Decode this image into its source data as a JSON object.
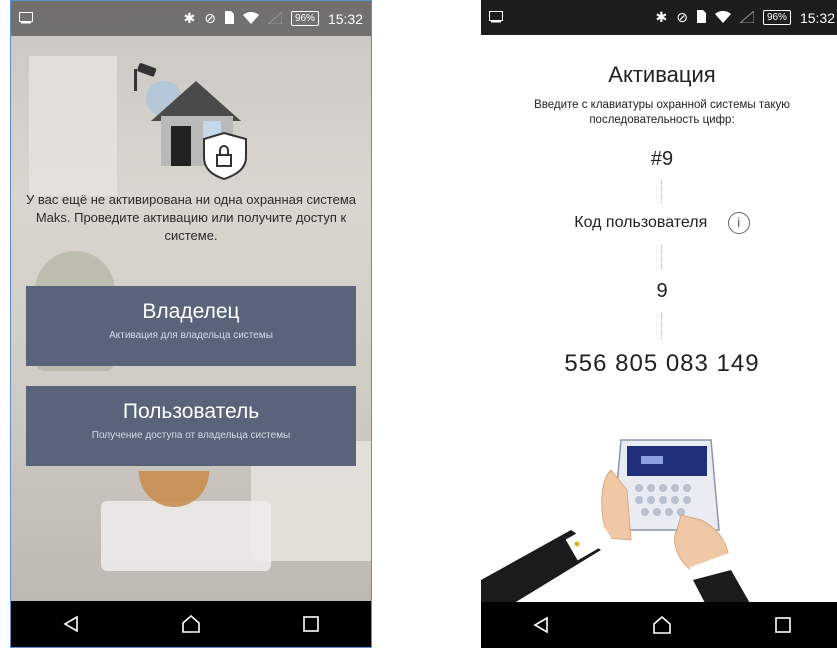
{
  "status_bar": {
    "time": "15:32",
    "battery": "96%"
  },
  "left_screen": {
    "intro_text": "У вас ещё не активирована ни одна охранная система Maks. Проведите активацию или получите доступ к системе.",
    "owner_button": {
      "title": "Владелец",
      "subtitle": "Активация для владельца системы"
    },
    "user_button": {
      "title": "Пользователь",
      "subtitle": "Получение доступа от владельца системы"
    }
  },
  "right_screen": {
    "title": "Активация",
    "instruction": "Введите с клавиатуры охранной системы такую последовательность цифр:",
    "step1_code": "#9",
    "user_code_label": "Код пользователя",
    "info_symbol": "i",
    "step2_code": "9",
    "final_code": "556 805 083 149"
  },
  "colors": {
    "button_bg": "#59647a",
    "navbar_bg": "#000000",
    "frame_border": "#5a8fd0"
  },
  "icons": [
    "cast-icon",
    "bluetooth-icon",
    "no-disturb-icon",
    "sim-icon",
    "wifi-icon",
    "signal-icon",
    "battery-icon",
    "back-icon",
    "home-icon",
    "recents-icon",
    "info-icon"
  ]
}
